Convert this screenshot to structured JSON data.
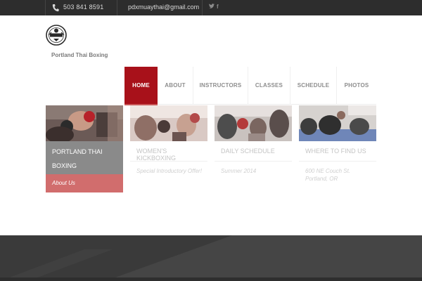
{
  "topbar": {
    "phone": "503 841 8591",
    "email": "pdxmuaythai@gmail.com",
    "phone_icon": "phone-icon",
    "social": [
      {
        "name": "twitter-icon",
        "glyph": "𝕥"
      },
      {
        "name": "facebook-icon",
        "glyph": "f"
      }
    ]
  },
  "header": {
    "site_name": "Portland Thai Boxing",
    "logo_icon": "logo-emblem-icon"
  },
  "nav": {
    "items": [
      {
        "label": "HOME"
      },
      {
        "label": "ABOUT"
      },
      {
        "label": "INSTRUCTORS"
      },
      {
        "label": "CLASSES"
      },
      {
        "label": "SCHEDULE"
      },
      {
        "label": "PHOTOS"
      }
    ],
    "active": "HOME"
  },
  "feature": {
    "title": "PORTLAND THAI BOXING",
    "link": "About Us"
  },
  "cards": [
    {
      "title": "WOMEN'S KICKBOXING",
      "sub": "Special Introductory Offer!"
    },
    {
      "title": "DAILY SCHEDULE",
      "sub": "Summer 2014"
    },
    {
      "title": "WHERE TO FIND US",
      "sub": "600 NE Couch St.\nPortland, OR"
    }
  ],
  "colors": {
    "accent": "#a8111a",
    "accent_light": "#d16d6d",
    "topbar": "#2d2d2d",
    "footer": "#3a3a3a"
  }
}
